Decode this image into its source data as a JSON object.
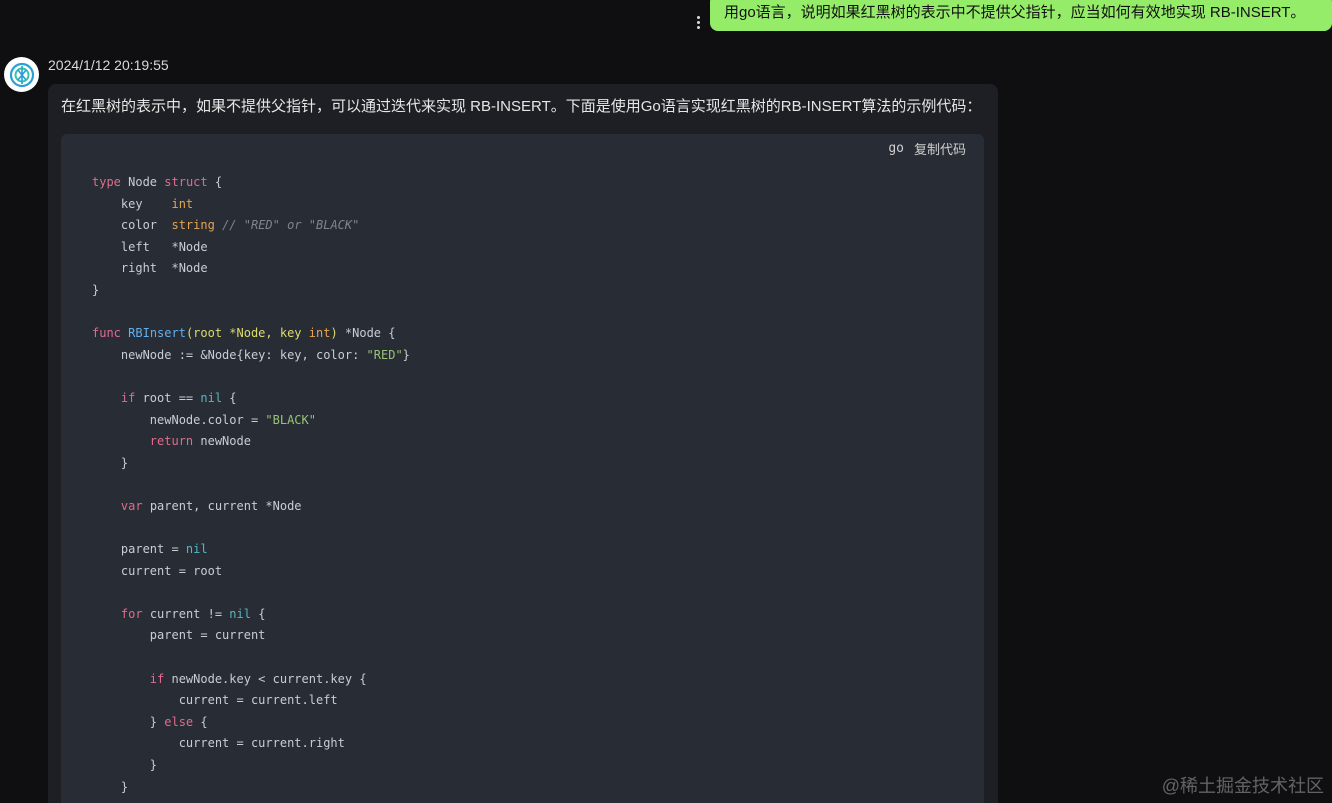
{
  "user_message": {
    "text": "用go语言，说明如果红黑树的表示中不提供父指针，应当如何有效地实现 RB-INSERT。"
  },
  "assistant": {
    "avatar_icon": "assistant-logo-icon",
    "timestamp": "2024/1/12 20:19:55",
    "intro": "在红黑树的表示中，如果不提供父指针，可以通过迭代来实现 RB-INSERT。下面是使用Go语言实现红黑树的RB-INSERT算法的示例代码：",
    "code_block": {
      "language": "go",
      "copy_label": "复制代码",
      "lines": [
        [
          {
            "t": "type",
            "c": "kw"
          },
          {
            "t": " Node "
          },
          {
            "t": "struct",
            "c": "kw"
          },
          {
            "t": " {"
          }
        ],
        [
          {
            "t": "    key    "
          },
          {
            "t": "int",
            "c": "ty"
          }
        ],
        [
          {
            "t": "    color  "
          },
          {
            "t": "string",
            "c": "ty"
          },
          {
            "t": " // \"RED\" or \"BLACK\"",
            "c": "cm"
          }
        ],
        [
          {
            "t": "    left   *Node"
          }
        ],
        [
          {
            "t": "    right  *Node"
          }
        ],
        [
          {
            "t": "}"
          }
        ],
        [],
        [
          {
            "t": "func",
            "c": "kw"
          },
          {
            "t": " "
          },
          {
            "t": "RBInsert",
            "c": "fn"
          },
          {
            "t": "(root *Node, key ",
            "c": "pm"
          },
          {
            "t": "int",
            "c": "ty"
          },
          {
            "t": ")",
            "c": "pm"
          },
          {
            "t": " *Node {"
          }
        ],
        [
          {
            "t": "    newNode := &Node{key: key, color: "
          },
          {
            "t": "\"RED\"",
            "c": "st"
          },
          {
            "t": "}"
          }
        ],
        [],
        [
          {
            "t": "    "
          },
          {
            "t": "if",
            "c": "kw"
          },
          {
            "t": " root == "
          },
          {
            "t": "nil",
            "c": "cy"
          },
          {
            "t": " {"
          }
        ],
        [
          {
            "t": "        newNode.color = "
          },
          {
            "t": "\"BLACK\"",
            "c": "st"
          }
        ],
        [
          {
            "t": "        "
          },
          {
            "t": "return",
            "c": "kw"
          },
          {
            "t": " newNode"
          }
        ],
        [
          {
            "t": "    }"
          }
        ],
        [],
        [
          {
            "t": "    "
          },
          {
            "t": "var",
            "c": "kw"
          },
          {
            "t": " parent, current *Node"
          }
        ],
        [],
        [
          {
            "t": "    parent = "
          },
          {
            "t": "nil",
            "c": "cy"
          }
        ],
        [
          {
            "t": "    current = root"
          }
        ],
        [],
        [
          {
            "t": "    "
          },
          {
            "t": "for",
            "c": "kw"
          },
          {
            "t": " current != "
          },
          {
            "t": "nil",
            "c": "cy"
          },
          {
            "t": " {"
          }
        ],
        [
          {
            "t": "        parent = current"
          }
        ],
        [],
        [
          {
            "t": "        "
          },
          {
            "t": "if",
            "c": "kw"
          },
          {
            "t": " newNode.key < current.key {"
          }
        ],
        [
          {
            "t": "            current = current.left"
          }
        ],
        [
          {
            "t": "        } "
          },
          {
            "t": "else",
            "c": "kw"
          },
          {
            "t": " {"
          }
        ],
        [
          {
            "t": "            current = current.right"
          }
        ],
        [
          {
            "t": "        }"
          }
        ],
        [
          {
            "t": "    }"
          }
        ]
      ]
    }
  },
  "watermark": "@稀土掘金技术社区",
  "colors": {
    "user_bubble": "#95ec69",
    "page_bg": "#0f0f12",
    "answer_bg": "#1e1f24",
    "code_bg": "#282c34"
  }
}
